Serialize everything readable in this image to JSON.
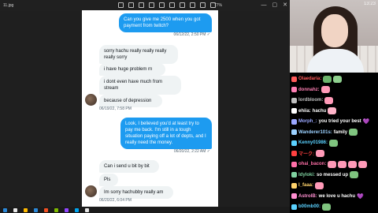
{
  "viewer": {
    "file_name": "11.jpg",
    "zoom": "77%",
    "window_controls": [
      "—",
      "▢",
      "✕"
    ]
  },
  "conversation": {
    "m1": {
      "text": "Can you give me 2500 when you got payment from twitch?",
      "time": "06/12/22, 2:50 PM ✓"
    },
    "m2": {
      "text": "sorry hachu really really really really sorry"
    },
    "m3": {
      "text": "i have huge problem rn"
    },
    "m4": {
      "text": "i dont even have much from stream"
    },
    "m5": {
      "text": "because of depression",
      "time": "06/19/22, 7:58 PM"
    },
    "m6": {
      "text": "Look, I believed you'd at least try to pay me back. I'm still in a tough situation paying off a lot of depts, and I really need the money.",
      "time": "06/20/22, 2:22 AM ✓"
    },
    "m7": {
      "text": "Can i send u bit by bit"
    },
    "m8": {
      "text": "Pls"
    },
    "m9": {
      "text": "Im sorry hachubby really am",
      "time": "06/20/22, 6:04 PM"
    }
  },
  "webcam": {
    "clock": "13:23"
  },
  "stream_chat": [
    {
      "user": "Olaedaria:",
      "color": "#ff5a5a",
      "text": "",
      "emotes": [
        "#6bb36b",
        "#8fd18f"
      ]
    },
    {
      "user": "donnahz:",
      "color": "#ff7fb4",
      "text": "",
      "emotes": [
        "#ff9ab8"
      ]
    },
    {
      "user": "lordbloom:",
      "color": "#bfbfbf",
      "text": "",
      "emotes": [
        "#ff9ab8"
      ]
    },
    {
      "user": "ehiia:",
      "color": "#ffffff",
      "text": "hachu",
      "emotes": [
        "#ffb3c8"
      ]
    },
    {
      "user": "Morph_:",
      "color": "#9aa7ff",
      "text": "you tried your best",
      "emotes": [],
      "heart": "💜"
    },
    {
      "user": "Wanderer101s:",
      "color": "#9bd1ff",
      "text": "family",
      "emotes": [
        "#7fc47f"
      ]
    },
    {
      "user": "Kenny01986:",
      "color": "#5ad1ff",
      "text": "",
      "emotes": [
        "#7fc47f"
      ]
    },
    {
      "user": "マーク:",
      "color": "#ff4040",
      "text": "",
      "emotes": [
        "#ff9ab8"
      ]
    },
    {
      "user": "ohai_bacon:",
      "color": "#ff6fa8",
      "text": "",
      "emotes": [
        "#ff9ab8",
        "#ff9ab8",
        "#ff9ab8",
        "#ff9ab8"
      ]
    },
    {
      "user": "ldyloki:",
      "color": "#7fd1a0",
      "text": "so messed up",
      "emotes": [
        "#7fc47f"
      ]
    },
    {
      "user": "l_faaa:",
      "color": "#ffd36b",
      "text": "",
      "emotes": [
        "#ff9ab8"
      ]
    },
    {
      "user": "AstrolB:",
      "color": "#ff8fd1",
      "text": "we love u hachu",
      "emotes": [],
      "heart": "💜"
    },
    {
      "user": "b00mb00:",
      "color": "#5ad1ff",
      "text": "",
      "emotes": [
        "#7fc47f"
      ]
    }
  ],
  "taskbar": {
    "icon_colors": [
      "#2b88d8",
      "#e8e8e8",
      "#ffb900",
      "#2b88d8",
      "#f25022",
      "#7fba00",
      "#9146ff",
      "#00a4ef",
      "#e8e8e8"
    ]
  }
}
